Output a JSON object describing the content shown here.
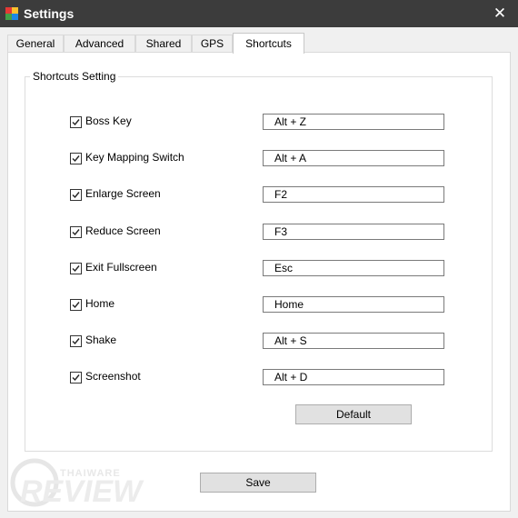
{
  "window": {
    "title": "Settings",
    "close_glyph": "✕",
    "app_icon": "app-logo-icon",
    "app_icon_colors": [
      "#e53935",
      "#fbc02d",
      "#43a047",
      "#1e88e5"
    ]
  },
  "tabs": [
    {
      "label": "General",
      "active": false
    },
    {
      "label": "Advanced",
      "active": false
    },
    {
      "label": "Shared",
      "active": false
    },
    {
      "label": "GPS",
      "active": false
    },
    {
      "label": "Shortcuts",
      "active": true
    }
  ],
  "group": {
    "title": "Shortcuts Setting"
  },
  "shortcuts": [
    {
      "label": "Boss Key",
      "checked": true,
      "value": "Alt + Z"
    },
    {
      "label": "Key Mapping Switch",
      "checked": true,
      "value": "Alt + A"
    },
    {
      "label": "Enlarge Screen",
      "checked": true,
      "value": "F2"
    },
    {
      "label": "Reduce Screen",
      "checked": true,
      "value": "F3"
    },
    {
      "label": "Exit Fullscreen",
      "checked": true,
      "value": "Esc"
    },
    {
      "label": "Home",
      "checked": true,
      "value": "Home"
    },
    {
      "label": "Shake",
      "checked": true,
      "value": "Alt + S"
    },
    {
      "label": "Screenshot",
      "checked": true,
      "value": "Alt + D"
    }
  ],
  "buttons": {
    "default_label": "Default",
    "save_label": "Save"
  },
  "watermark": {
    "line1": "THAIWARE",
    "line2": "REVIEW"
  }
}
